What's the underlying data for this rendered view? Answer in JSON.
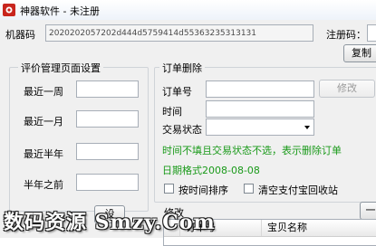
{
  "window": {
    "title": "神器软件 - 未注册"
  },
  "header": {
    "machine_code_label": "机器码",
    "machine_code_value": "2020202057202d444d5759414d55363235313131",
    "reg_code_label": "注册码：",
    "copy_button": "复制"
  },
  "review_group": {
    "title": "评价管理页面设置",
    "rows": [
      {
        "label": "最近一周",
        "value": ""
      },
      {
        "label": "最近一月",
        "value": ""
      },
      {
        "label": "最近半年",
        "value": ""
      },
      {
        "label": "半年之前",
        "value": ""
      }
    ],
    "button_partial": "设"
  },
  "order_group": {
    "title": "订单删除",
    "order_no_label": "订单号",
    "order_no_value": "",
    "time_label": "时间",
    "time_value": "",
    "status_label": "交易状态",
    "status_value": "",
    "modify_button": "修改",
    "note_red": "时间不填且交易状态不选，表示删除订单",
    "note_date": "日期格式2008-08-08",
    "sort_by_time_label": "按时间排序",
    "clear_recycle_label": "清空支付宝回收站",
    "sort_by_time_checked": false,
    "clear_recycle_checked": false
  },
  "list": {
    "title_partial": "修改",
    "columns": [
      "订单号",
      "宝贝名称"
    ],
    "right_button_partial": "一"
  },
  "watermark": "数码资源 Smzy.Com"
}
